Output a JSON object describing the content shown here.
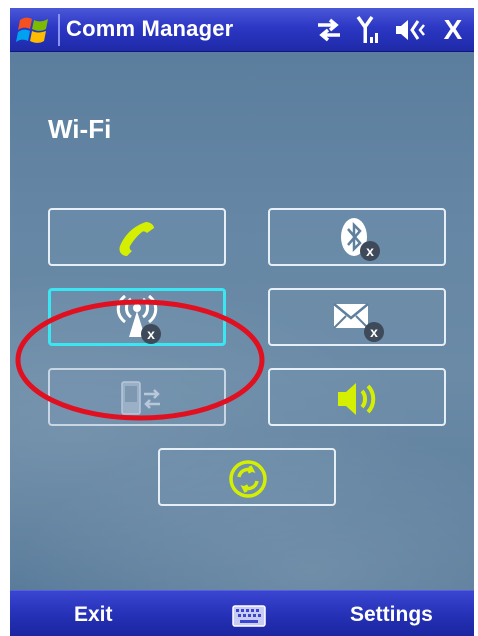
{
  "title_bar": {
    "app_title": "Comm Manager",
    "close_glyph": "X",
    "icons": [
      "windows-start-flag-icon",
      "sync-arrows-icon",
      "signal-antenna-icon",
      "speaker-muted-icon"
    ]
  },
  "content": {
    "status_label": "Wi-Fi",
    "tiles": [
      {
        "name": "phone-toggle",
        "icon": "phone-handset-icon",
        "state": "on"
      },
      {
        "name": "bluetooth-toggle",
        "icon": "bluetooth-icon",
        "state": "off"
      },
      {
        "name": "wifi-toggle",
        "icon": "wifi-antenna-icon",
        "state": "off",
        "selected": true
      },
      {
        "name": "direct-push-toggle",
        "icon": "envelope-icon",
        "state": "off"
      },
      {
        "name": "activesync-toggle",
        "icon": "device-sync-icon",
        "state": "disabled"
      },
      {
        "name": "sound-toggle",
        "icon": "speaker-sound-icon",
        "state": "on"
      },
      {
        "name": "sync-now-button",
        "icon": "sync-circle-icon",
        "state": "on"
      }
    ],
    "annotation": "red-highlight-ellipse"
  },
  "menu_bar": {
    "left_softkey": "Exit",
    "right_softkey": "Settings",
    "center_icon": "keyboard-icon"
  },
  "colors": {
    "title_bar": "#2c37c4",
    "content_bg": "#6687a5",
    "tile_border": "#e6eef6",
    "selected_border": "#39e6f2",
    "active_icon": "#d4f000",
    "off_badge": "#3e4a5a",
    "highlight": "#e01020"
  }
}
